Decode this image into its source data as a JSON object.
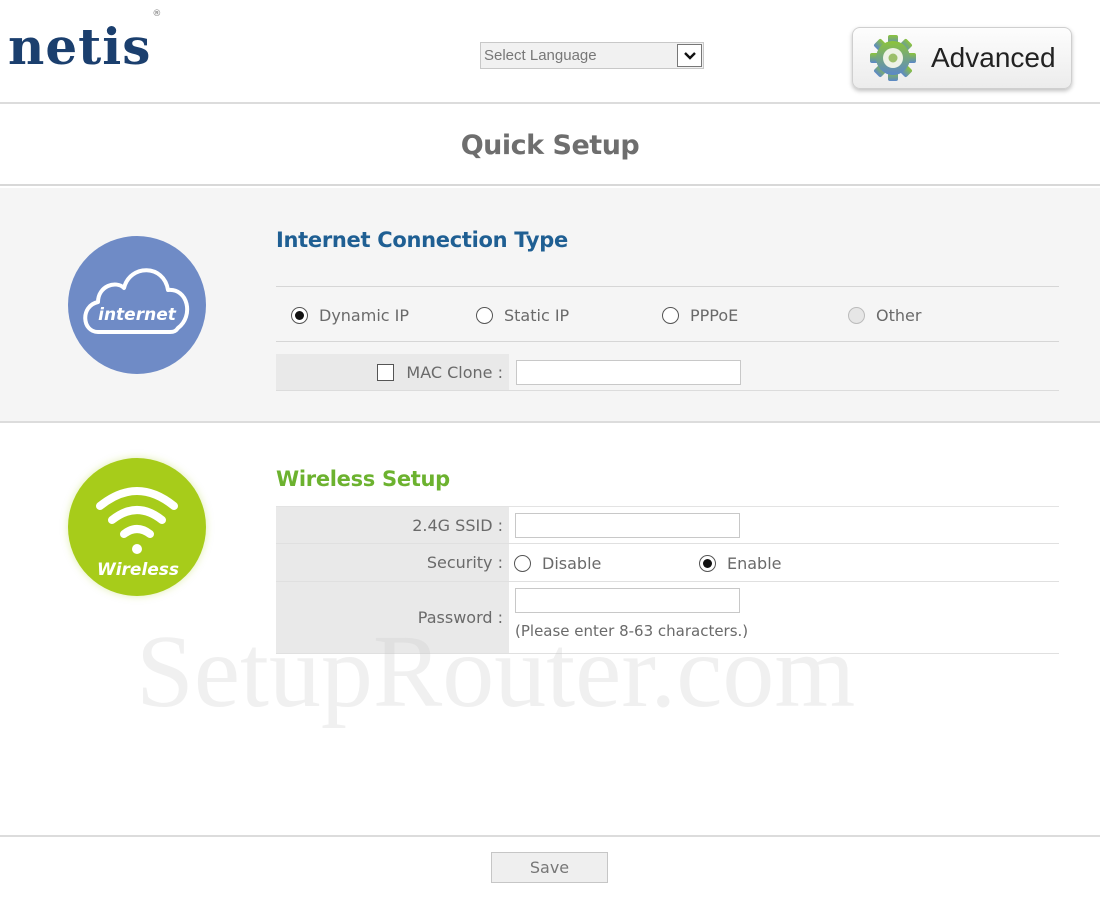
{
  "header": {
    "logo_text": "netis",
    "logo_mark": "®",
    "language_select": {
      "selected": "Select Language",
      "icon": "chevron-down-icon"
    },
    "advanced_button": {
      "label": "Advanced",
      "icon": "gear-icon"
    }
  },
  "page_title": "Quick Setup",
  "internet": {
    "icon_label": "internet",
    "title": "Internet Connection Type",
    "connection_types": [
      {
        "label": "Dynamic IP",
        "selected": true,
        "disabled": false
      },
      {
        "label": "Static IP",
        "selected": false,
        "disabled": false
      },
      {
        "label": "PPPoE",
        "selected": false,
        "disabled": false
      },
      {
        "label": "Other",
        "selected": false,
        "disabled": true
      }
    ],
    "mac_clone": {
      "label": "MAC Clone :",
      "checked": false,
      "value": ""
    }
  },
  "wireless": {
    "icon_label": "Wireless",
    "title": "Wireless Setup",
    "ssid": {
      "label": "2.4G SSID :",
      "value": ""
    },
    "security": {
      "label": "Security :",
      "options": [
        {
          "label": "Disable",
          "selected": false
        },
        {
          "label": "Enable",
          "selected": true
        }
      ]
    },
    "password": {
      "label": "Password :",
      "value": "",
      "hint": "(Please enter 8-63 characters.)"
    }
  },
  "watermark": "SetupRouter.com",
  "footer": {
    "save_label": "Save"
  },
  "colors": {
    "logo": "#1b3f6e",
    "internet_title": "#1f5f93",
    "wireless_title": "#6cb22f",
    "internet_circle": "#6f8bc6",
    "wireless_circle": "#a7cc1a"
  }
}
